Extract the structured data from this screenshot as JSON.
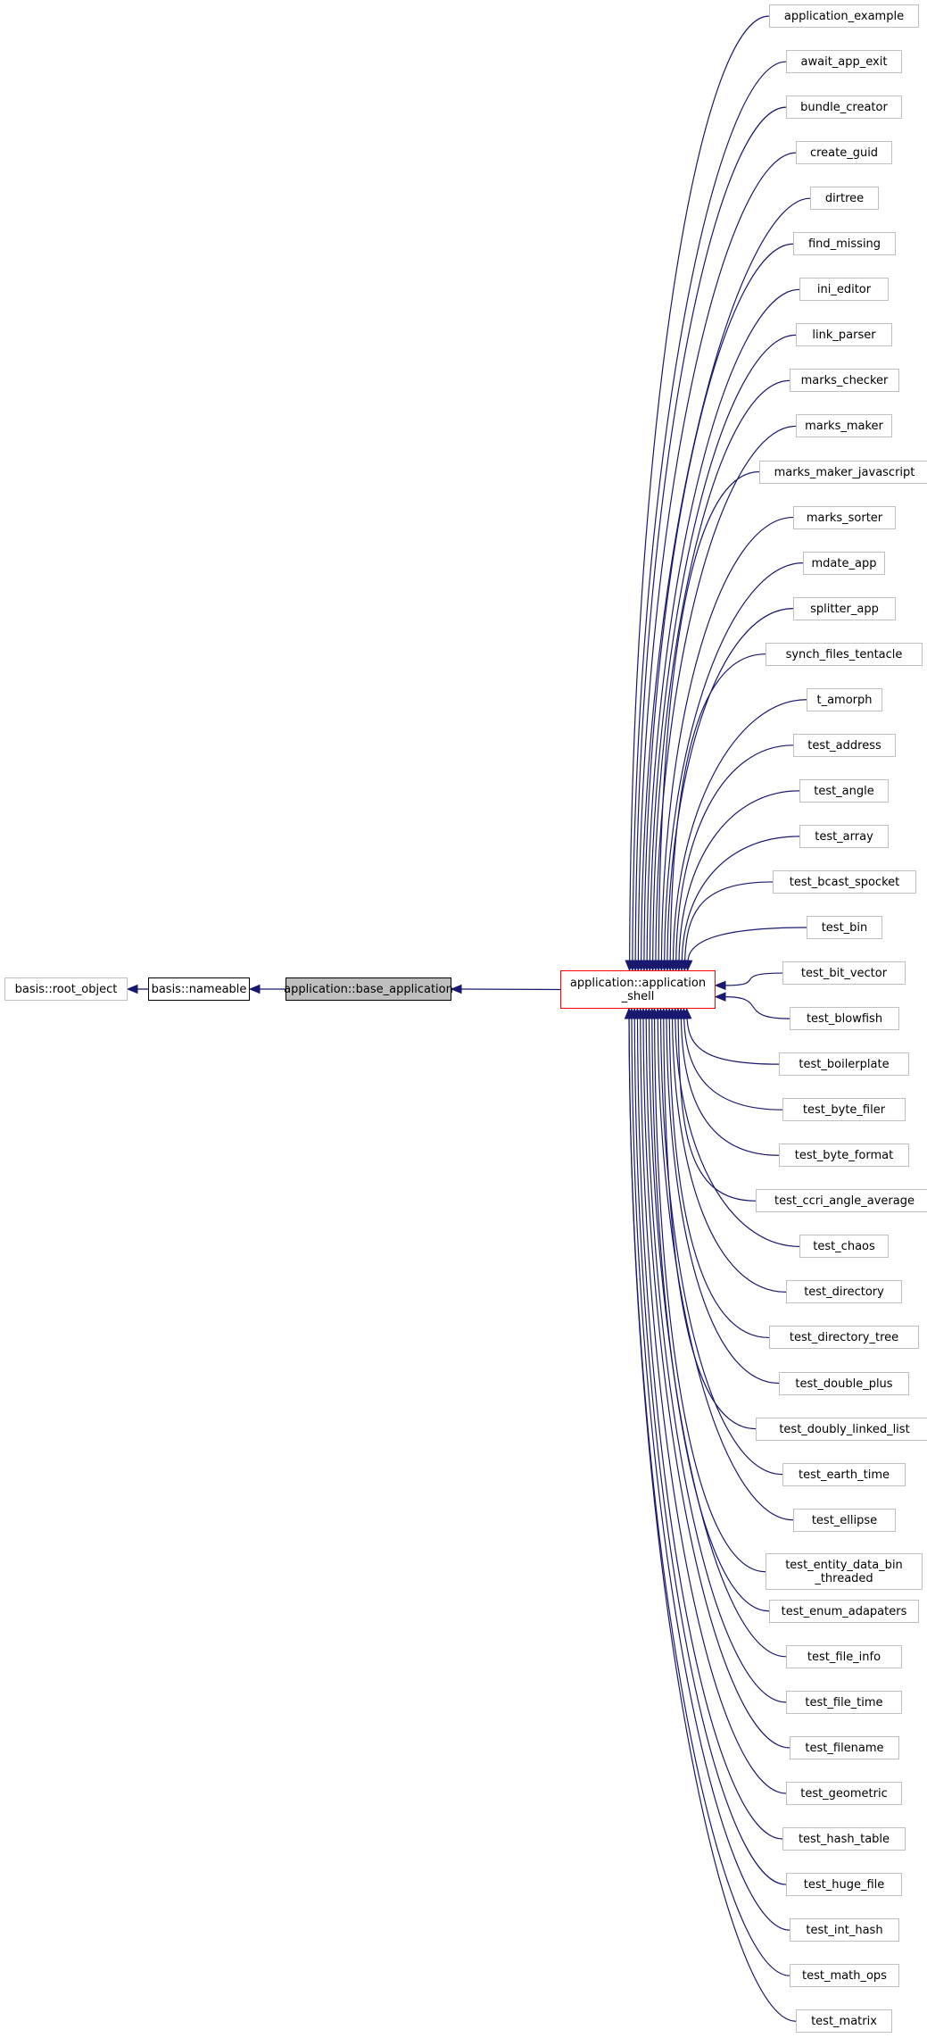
{
  "diagram": {
    "type": "inheritance-graph",
    "edge_color": "#191970",
    "chain": [
      {
        "id": "root_object",
        "label": "basis::root_object",
        "style": "gray"
      },
      {
        "id": "nameable",
        "label": "basis::nameable",
        "style": "dark"
      },
      {
        "id": "base_application",
        "label": "application::base_application",
        "style": "current"
      },
      {
        "id": "application_shell",
        "label": "application::application\n_shell",
        "style": "focus"
      }
    ],
    "chain_edges": [
      {
        "from": "nameable",
        "to": "root_object"
      },
      {
        "from": "base_application",
        "to": "nameable"
      },
      {
        "from": "application_shell",
        "to": "base_application"
      }
    ],
    "derived_parent": "application_shell",
    "derived": [
      "application_example",
      "await_app_exit",
      "bundle_creator",
      "create_guid",
      "dirtree",
      "find_missing",
      "ini_editor",
      "link_parser",
      "marks_checker",
      "marks_maker",
      "marks_maker_javascript",
      "marks_sorter",
      "mdate_app",
      "splitter_app",
      "synch_files_tentacle",
      "t_amorph",
      "test_address",
      "test_angle",
      "test_array",
      "test_bcast_spocket",
      "test_bin",
      "test_bit_vector",
      "test_blowfish",
      "test_boilerplate",
      "test_byte_filer",
      "test_byte_format",
      "test_ccri_angle_average",
      "test_chaos",
      "test_directory",
      "test_directory_tree",
      "test_double_plus",
      "test_doubly_linked_list",
      "test_earth_time",
      "test_ellipse",
      "test_entity_data_bin\n_threaded",
      "test_enum_adapaters",
      "test_file_info",
      "test_file_time",
      "test_filename",
      "test_geometric",
      "test_hash_table",
      "test_huge_file",
      "test_int_hash",
      "test_math_ops",
      "test_matrix"
    ]
  }
}
